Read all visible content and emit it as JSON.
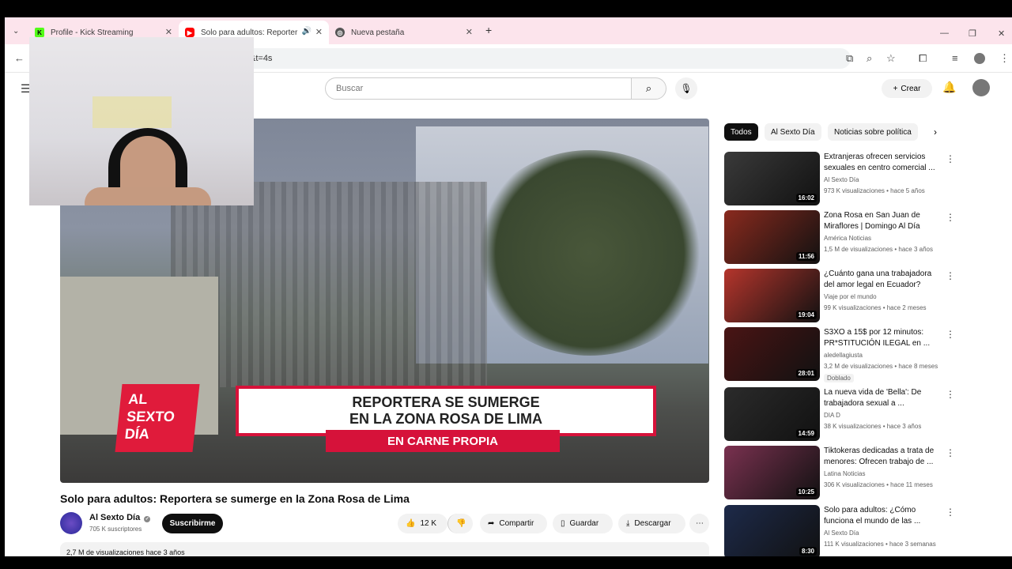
{
  "browser": {
    "tabs": [
      {
        "title": "Profile - Kick Streaming",
        "icon": "kick-icon"
      },
      {
        "title": "Solo para adultos: Reporter",
        "icon": "youtube-icon"
      },
      {
        "title": "Nueva pestaña",
        "icon": "chrome-icon"
      }
    ],
    "new_tab_label": "+",
    "url_visible": "&t=4s"
  },
  "youtube": {
    "search_placeholder": "Buscar",
    "create_label": "Crear",
    "video": {
      "banner_line1": "REPORTERA SE SUMERGE",
      "banner_line2": "EN LA ZONA ROSA DE LIMA",
      "banner_sub": "EN CARNE PROPIA",
      "logo_line1": "AL",
      "logo_line2": "SEXTO",
      "logo_line3": "DÍA",
      "title": "Solo para adultos: Reportera se sumerge en la Zona Rosa de Lima",
      "channel": "Al Sexto Día",
      "subscribers": "705 K suscriptores",
      "subscribe_label": "Suscribirme",
      "likes": "12 K",
      "share_label": "Compartir",
      "save_label": "Guardar",
      "download_label": "Descargar",
      "views_line": "2,7 M de visualizaciones  hace 3 años"
    },
    "chips": [
      "Todos",
      "Al Sexto Día",
      "Noticias sobre política"
    ],
    "recommendations": [
      {
        "title": "Extranjeras ofrecen servicios sexuales en centro comercial ...",
        "channel": "Al Sexto Día",
        "meta": "973 K visualizaciones • hace 5 años",
        "duration": "16:02",
        "color": "#3a3a3a"
      },
      {
        "title": "Zona Rosa en San Juan de Miraflores | Domingo Al Día",
        "channel": "América Noticias",
        "meta": "1,5 M de visualizaciones • hace 3 años",
        "duration": "11:56",
        "color": "#8a2a1e"
      },
      {
        "title": "¿Cuánto gana una trabajadora del amor legal en Ecuador?",
        "channel": "Viaje por el mundo",
        "meta": "99 K visualizaciones • hace 2 meses",
        "duration": "19:04",
        "color": "#b5352c"
      },
      {
        "title": "S3XO a 15$ por 12 minutos: PR*STITUCIÓN ILEGAL en ...",
        "channel": "aledellagiusta",
        "meta": "3,2 M de visualizaciones • hace 8 meses",
        "duration": "28:01",
        "color": "#4a1414",
        "badge": "Doblado"
      },
      {
        "title": "La nueva vida de 'Bella': De trabajadora sexual a ...",
        "channel": "DIA D",
        "meta": "38 K visualizaciones • hace 3 años",
        "duration": "14:59",
        "color": "#2b2b2b"
      },
      {
        "title": "Tiktokeras dedicadas a trata de menores: Ofrecen trabajo de ...",
        "channel": "Latina Noticias",
        "meta": "306 K visualizaciones • hace 11 meses",
        "duration": "10:25",
        "color": "#7a3150"
      },
      {
        "title": "Solo para adultos: ¿Cómo funciona el mundo de las ...",
        "channel": "Al Sexto Día",
        "meta": "111 K visualizaciones • hace 3 semanas",
        "duration": "8:30",
        "color": "#1d2a4a"
      }
    ]
  }
}
